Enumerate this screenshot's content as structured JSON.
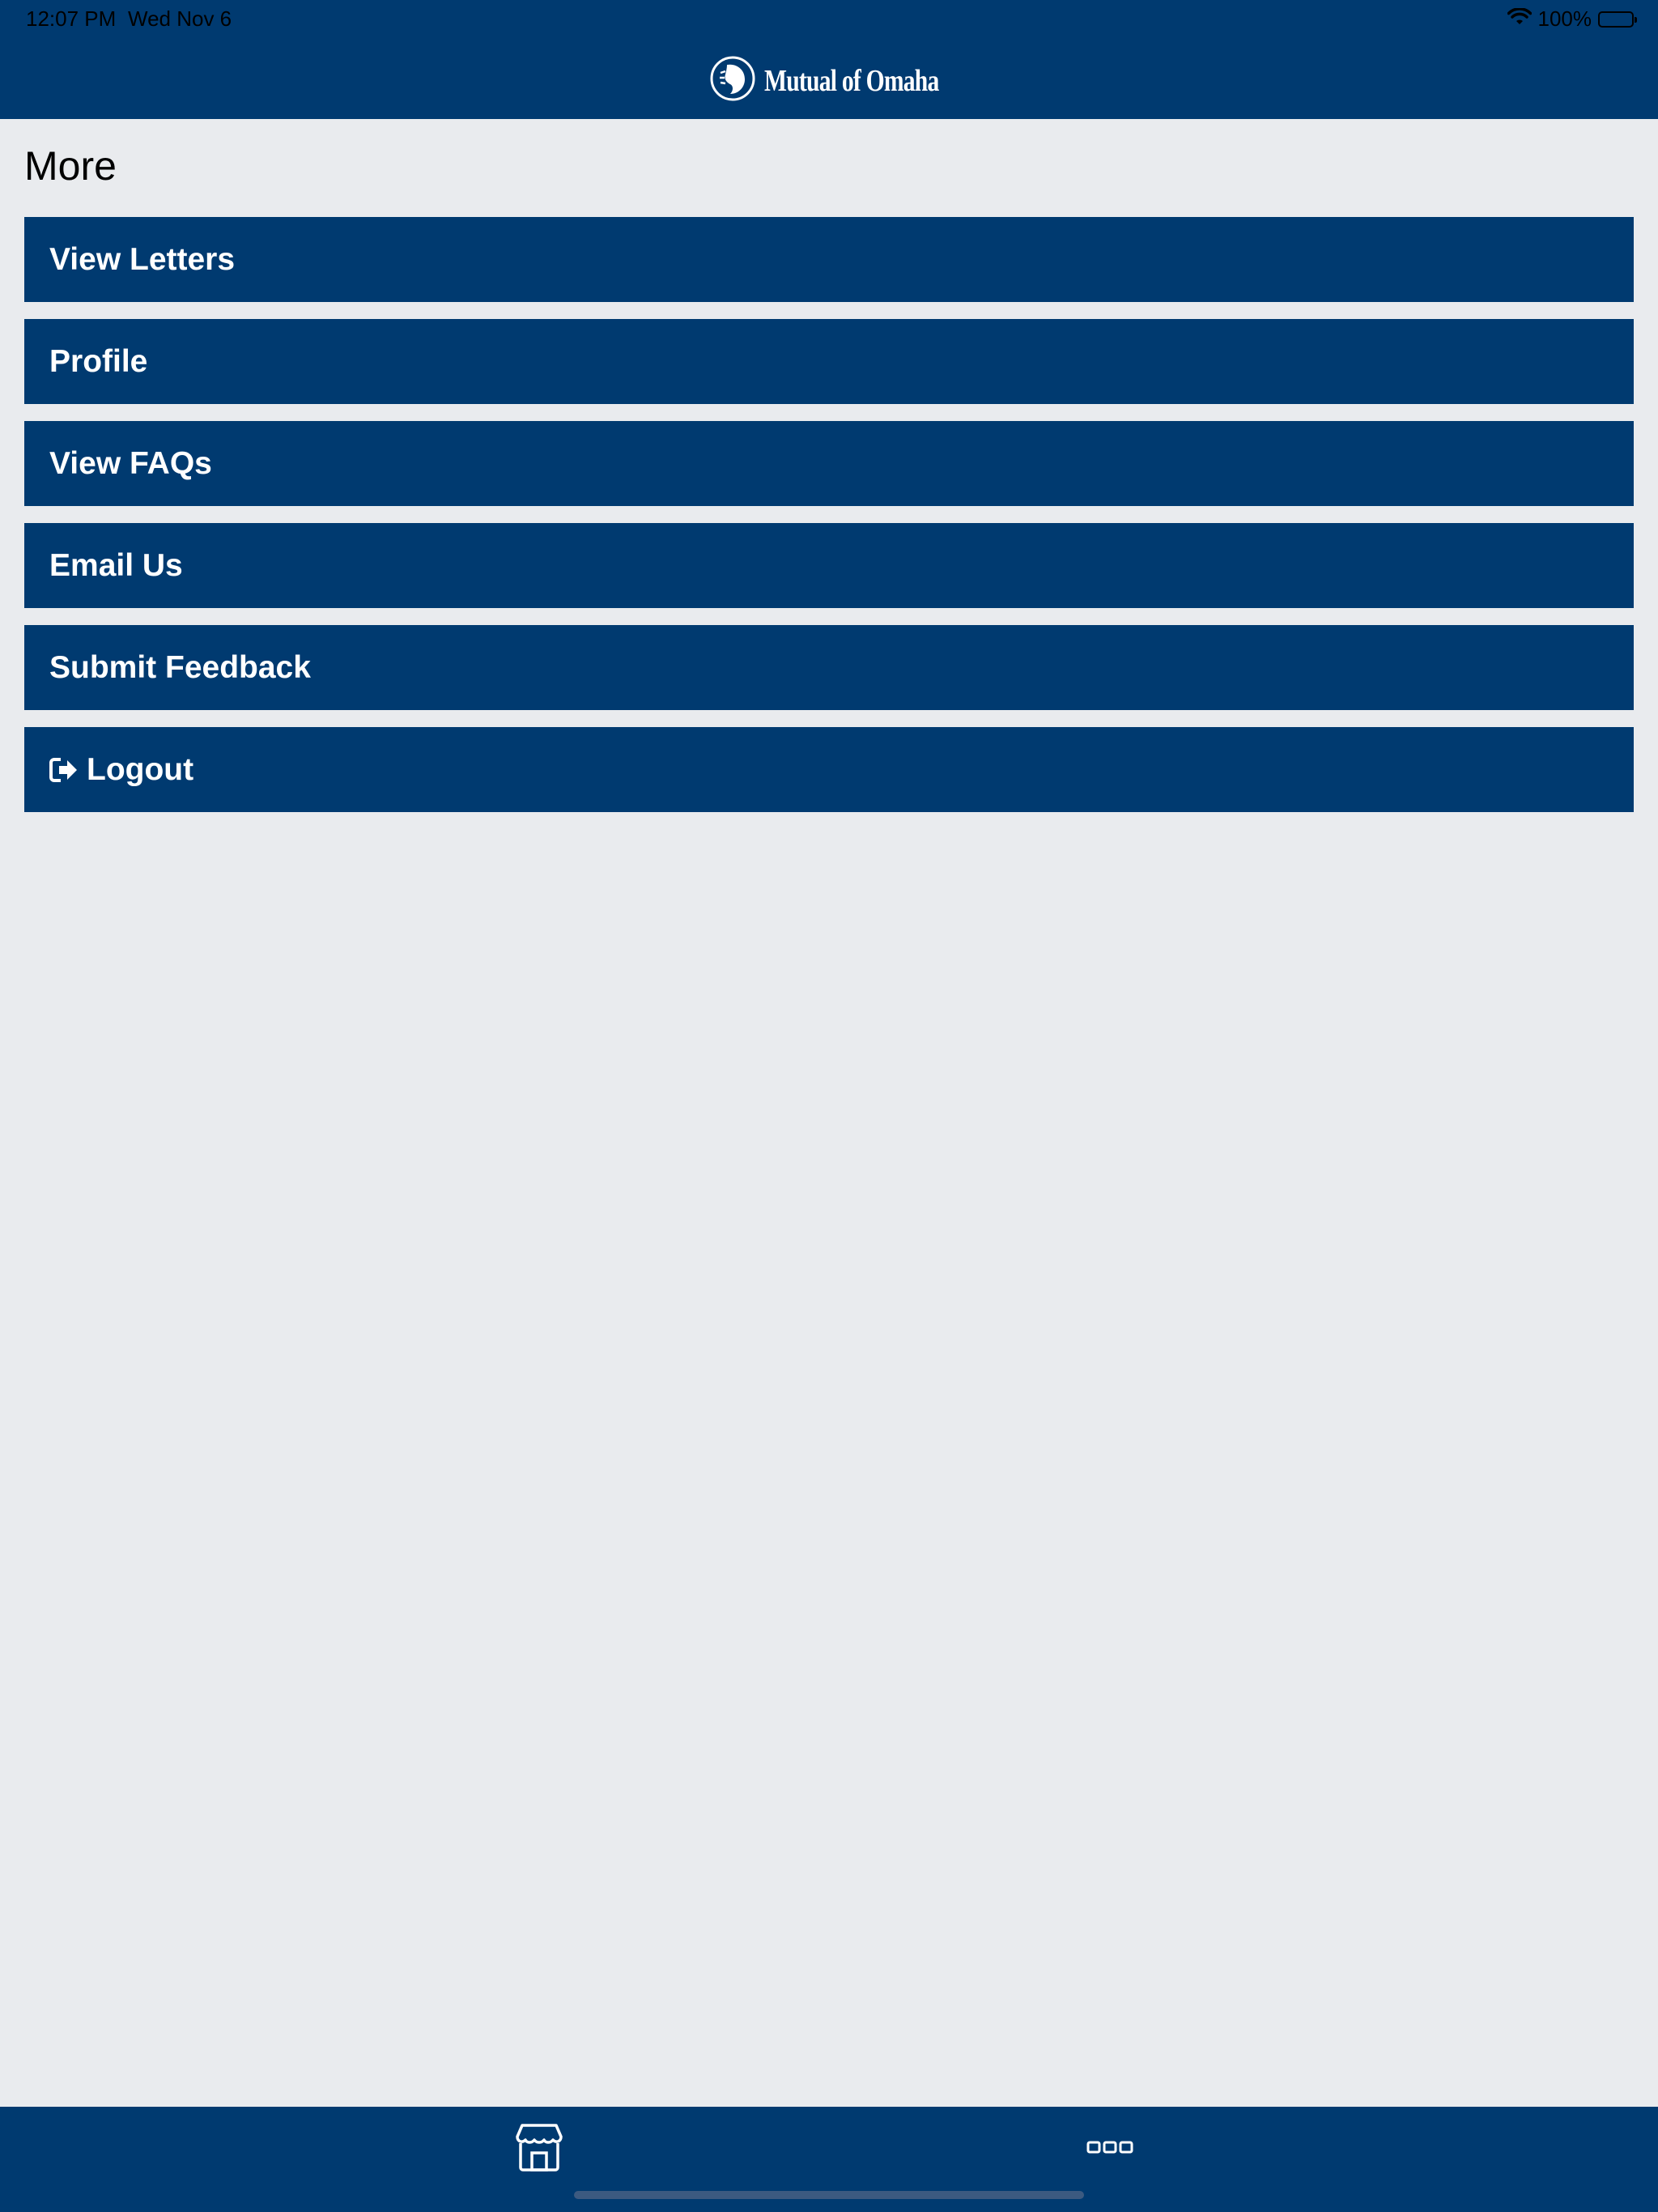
{
  "status_bar": {
    "time": "12:07 PM",
    "date": "Wed Nov 6",
    "battery": "100%"
  },
  "header": {
    "logo_text": "Mutual of Omaha"
  },
  "page": {
    "title": "More"
  },
  "menu": {
    "items": [
      {
        "label": "View Letters"
      },
      {
        "label": "Profile"
      },
      {
        "label": "View FAQs"
      },
      {
        "label": "Email Us"
      },
      {
        "label": "Submit Feedback"
      },
      {
        "label": "Logout",
        "icon": "logout-icon"
      }
    ]
  },
  "tab_bar": {
    "tabs": [
      {
        "icon": "storefront-icon"
      },
      {
        "icon": "more-dots-icon"
      }
    ]
  },
  "colors": {
    "brand": "#003a70",
    "background": "#e9ebee",
    "text_on_brand": "#ffffff"
  }
}
